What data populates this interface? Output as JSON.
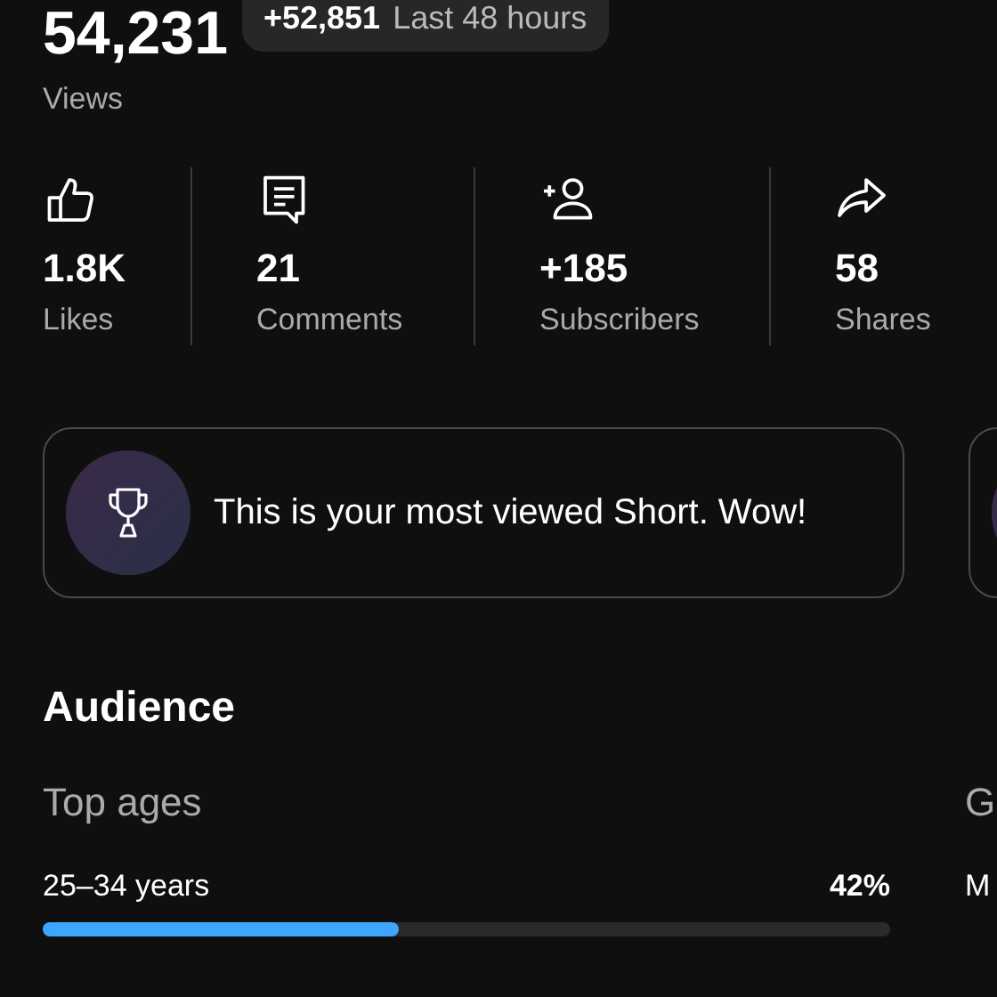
{
  "views": {
    "value": "54,231",
    "label": "Views",
    "badge": {
      "delta": "+52,851",
      "period": "Last 48 hours"
    }
  },
  "stats": [
    {
      "kind": "likes",
      "value": "1.8K",
      "label": "Likes"
    },
    {
      "kind": "comments",
      "value": "21",
      "label": "Comments"
    },
    {
      "kind": "subscribers",
      "value": "+185",
      "label": "Subscribers"
    },
    {
      "kind": "shares",
      "value": "58",
      "label": "Shares"
    }
  ],
  "highlights": [
    {
      "kind": "trophy",
      "text": "This is your most viewed Short. Wow!"
    },
    {
      "kind": "partial"
    }
  ],
  "audience": {
    "title": "Audience",
    "columns": [
      {
        "title": "Top ages",
        "rows": [
          {
            "label": "25–34 years",
            "value": "42%",
            "level": 0.42
          }
        ]
      },
      {
        "title": "G",
        "rows": [
          {
            "label": "M"
          }
        ]
      }
    ]
  }
}
